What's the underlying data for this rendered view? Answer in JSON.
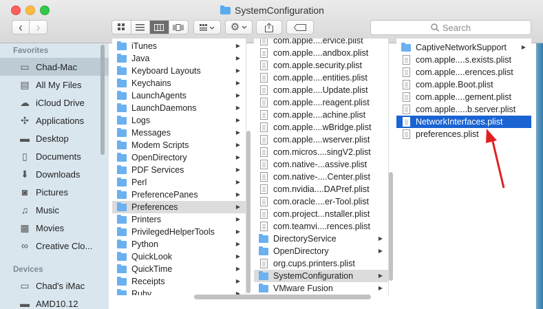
{
  "window": {
    "title": "SystemConfiguration"
  },
  "toolbar": {
    "back": "‹",
    "forward": "›",
    "search_placeholder": "Search"
  },
  "sidebar": {
    "favorites_header": "Favorites",
    "favorites": [
      {
        "label": "Chad-Mac",
        "icon": "hard-drive-icon"
      },
      {
        "label": "All My Files",
        "icon": "files-icon"
      },
      {
        "label": "iCloud Drive",
        "icon": "cloud-icon"
      },
      {
        "label": "Applications",
        "icon": "applications-icon"
      },
      {
        "label": "Desktop",
        "icon": "desktop-icon"
      },
      {
        "label": "Documents",
        "icon": "documents-icon"
      },
      {
        "label": "Downloads",
        "icon": "downloads-icon"
      },
      {
        "label": "Pictures",
        "icon": "camera-icon"
      },
      {
        "label": "Music",
        "icon": "music-icon"
      },
      {
        "label": "Movies",
        "icon": "film-icon"
      },
      {
        "label": "Creative Clo...",
        "icon": "creative-cloud-icon"
      }
    ],
    "devices_header": "Devices",
    "devices": [
      {
        "label": "Chad's iMac",
        "icon": "imac-icon"
      },
      {
        "label": "AMD10.12",
        "icon": "disk-icon"
      }
    ]
  },
  "column1": {
    "items": [
      {
        "label": "iTunes",
        "type": "folder"
      },
      {
        "label": "Java",
        "type": "folder"
      },
      {
        "label": "Keyboard Layouts",
        "type": "folder"
      },
      {
        "label": "Keychains",
        "type": "folder"
      },
      {
        "label": "LaunchAgents",
        "type": "folder"
      },
      {
        "label": "LaunchDaemons",
        "type": "folder"
      },
      {
        "label": "Logs",
        "type": "folder"
      },
      {
        "label": "Messages",
        "type": "folder"
      },
      {
        "label": "Modem Scripts",
        "type": "folder"
      },
      {
        "label": "OpenDirectory",
        "type": "folder"
      },
      {
        "label": "PDF Services",
        "type": "folder"
      },
      {
        "label": "Perl",
        "type": "folder"
      },
      {
        "label": "PreferencePanes",
        "type": "folder"
      },
      {
        "label": "Preferences",
        "type": "folder"
      },
      {
        "label": "Printers",
        "type": "folder"
      },
      {
        "label": "PrivilegedHelperTools",
        "type": "folder"
      },
      {
        "label": "Python",
        "type": "folder"
      },
      {
        "label": "QuickLook",
        "type": "folder"
      },
      {
        "label": "QuickTime",
        "type": "folder"
      },
      {
        "label": "Receipts",
        "type": "folder"
      },
      {
        "label": "Ruby",
        "type": "folder"
      }
    ]
  },
  "column2": {
    "items": [
      {
        "label": "com.apple....ervice.plist",
        "type": "file"
      },
      {
        "label": "com.apple....andbox.plist",
        "type": "file"
      },
      {
        "label": "com.apple.security.plist",
        "type": "file"
      },
      {
        "label": "com.apple....entities.plist",
        "type": "file"
      },
      {
        "label": "com.apple....Update.plist",
        "type": "file"
      },
      {
        "label": "com.apple....reagent.plist",
        "type": "file"
      },
      {
        "label": "com.apple....achine.plist",
        "type": "file"
      },
      {
        "label": "com.apple....wBridge.plist",
        "type": "file"
      },
      {
        "label": "com.apple....wserver.plist",
        "type": "file"
      },
      {
        "label": "com.micros....singV2.plist",
        "type": "file"
      },
      {
        "label": "com.native-...assive.plist",
        "type": "file"
      },
      {
        "label": "com.native-....Center.plist",
        "type": "file"
      },
      {
        "label": "com.nvidia....DAPref.plist",
        "type": "file"
      },
      {
        "label": "com.oracle....er-Tool.plist",
        "type": "file"
      },
      {
        "label": "com.project...nstaller.plist",
        "type": "file"
      },
      {
        "label": "com.teamvi....rences.plist",
        "type": "file"
      },
      {
        "label": "DirectoryService",
        "type": "folder"
      },
      {
        "label": "OpenDirectory",
        "type": "folder"
      },
      {
        "label": "org.cups.printers.plist",
        "type": "file"
      },
      {
        "label": "SystemConfiguration",
        "type": "folder"
      },
      {
        "label": "VMware Fusion",
        "type": "folder"
      }
    ]
  },
  "column3": {
    "items": [
      {
        "label": "CaptiveNetworkSupport",
        "type": "folder"
      },
      {
        "label": "com.apple....s.exists.plist",
        "type": "file"
      },
      {
        "label": "com.apple....erences.plist",
        "type": "file"
      },
      {
        "label": "com.apple.Boot.plist",
        "type": "file"
      },
      {
        "label": "com.apple....gement.plist",
        "type": "file"
      },
      {
        "label": "com.apple.....b.server.plist",
        "type": "file"
      },
      {
        "label": "NetworkInterfaces.plist",
        "type": "file"
      },
      {
        "label": "preferences.plist",
        "type": "file"
      }
    ]
  },
  "colors": {
    "selection": "#1a63d2",
    "sidebar_bg": "#d9e6ee",
    "annotation_arrow": "#e02020"
  }
}
